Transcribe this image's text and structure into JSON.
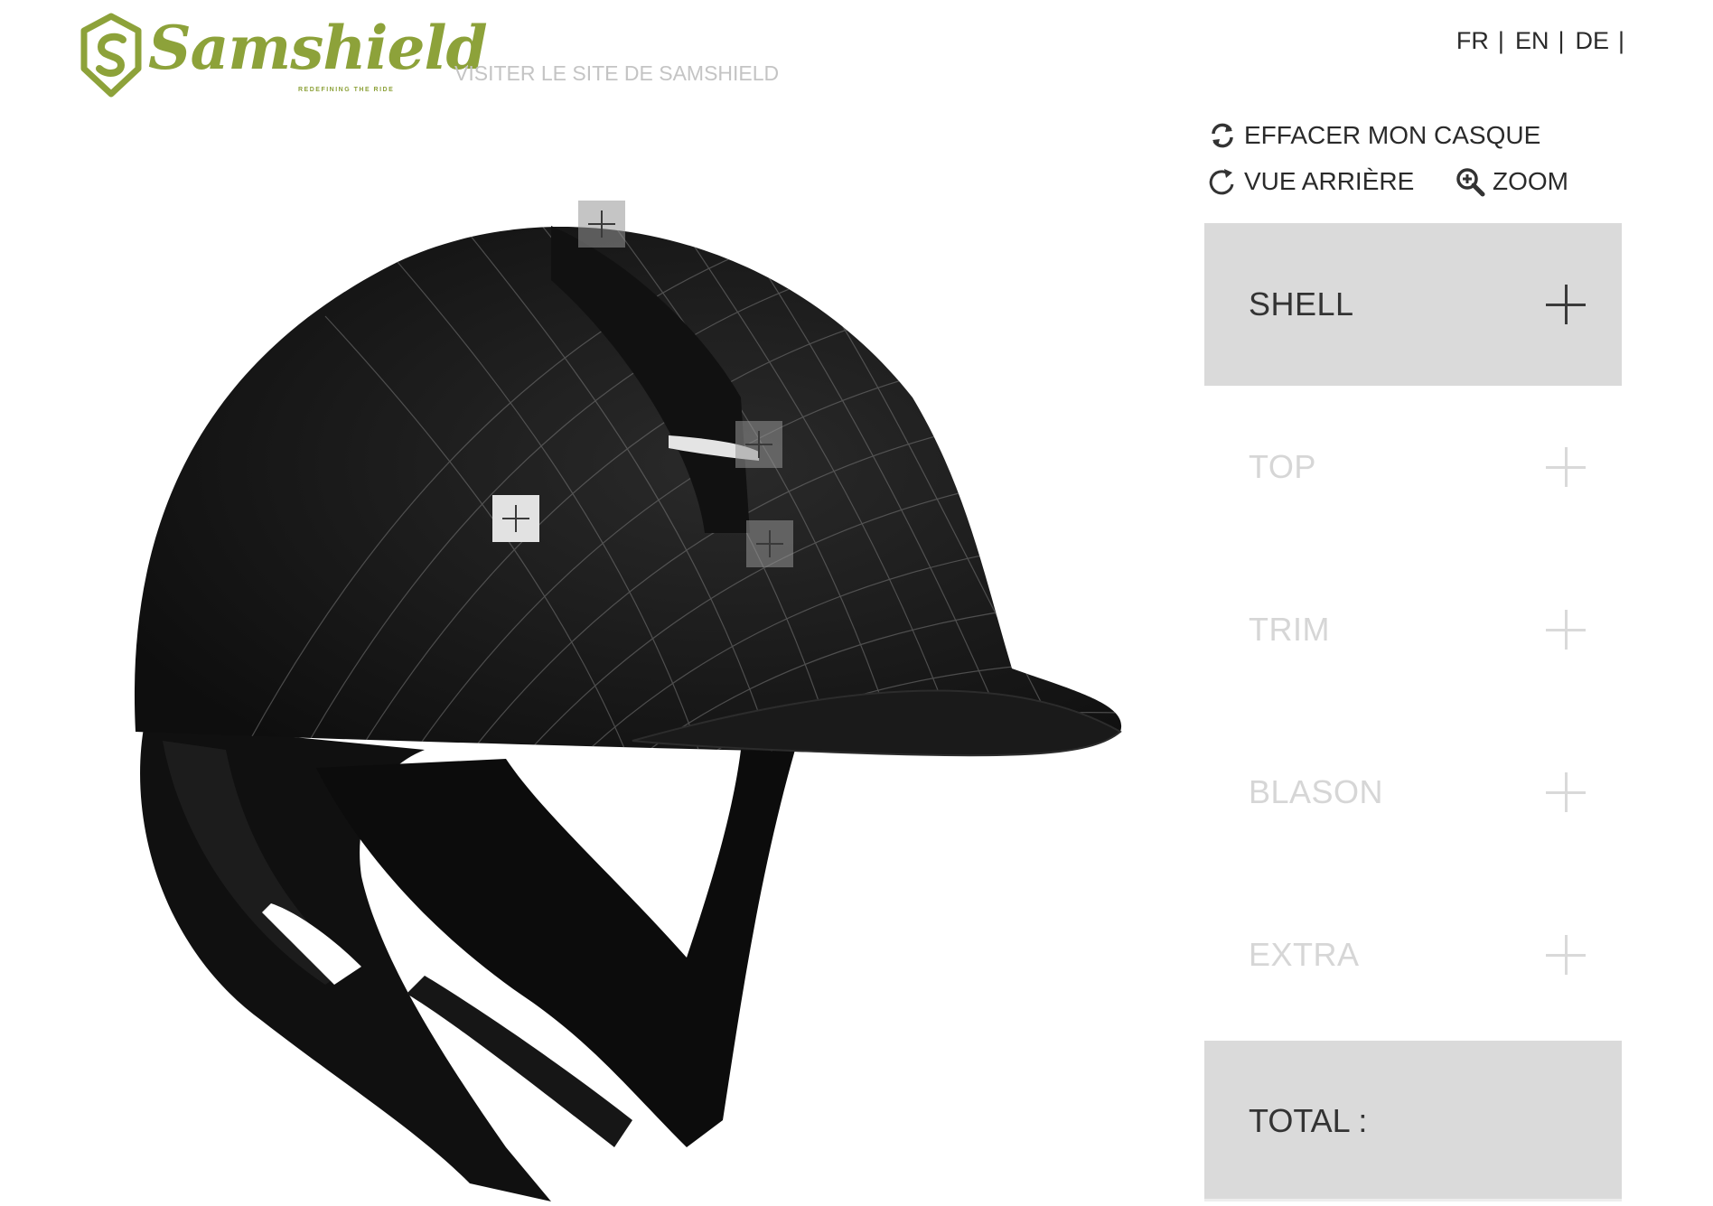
{
  "header": {
    "brand_name": "Samshield",
    "brand_tagline": "REDEFINING THE RIDE",
    "site_link": "VISITER LE SITE DE SAMSHIELD",
    "languages": [
      {
        "code": "FR",
        "sep": "|"
      },
      {
        "code": "EN",
        "sep": "|"
      },
      {
        "code": "DE",
        "sep": "|"
      }
    ]
  },
  "actions": {
    "reset": {
      "label": "EFFACER MON CASQUE",
      "icon": "refresh-icon"
    },
    "back_view": {
      "label": "VUE ARRIÈRE",
      "icon": "rotate-icon"
    },
    "zoom": {
      "label": "ZOOM",
      "icon": "zoom-in-icon"
    }
  },
  "customizer": {
    "sections": [
      {
        "label": "SHELL",
        "active": true
      },
      {
        "label": "TOP",
        "active": false
      },
      {
        "label": "TRIM",
        "active": false
      },
      {
        "label": "BLASON",
        "active": false
      },
      {
        "label": "EXTRA",
        "active": false
      }
    ],
    "total_label": "TOTAL :"
  },
  "helmet_preview": {
    "hotspots": [
      "top-vent",
      "blason",
      "shell",
      "trim"
    ]
  },
  "colors": {
    "brand_green": "#8da23a",
    "panel_active_bg": "#dadada",
    "panel_inactive_text": "#d6d6d6",
    "helmet": "#141414"
  }
}
